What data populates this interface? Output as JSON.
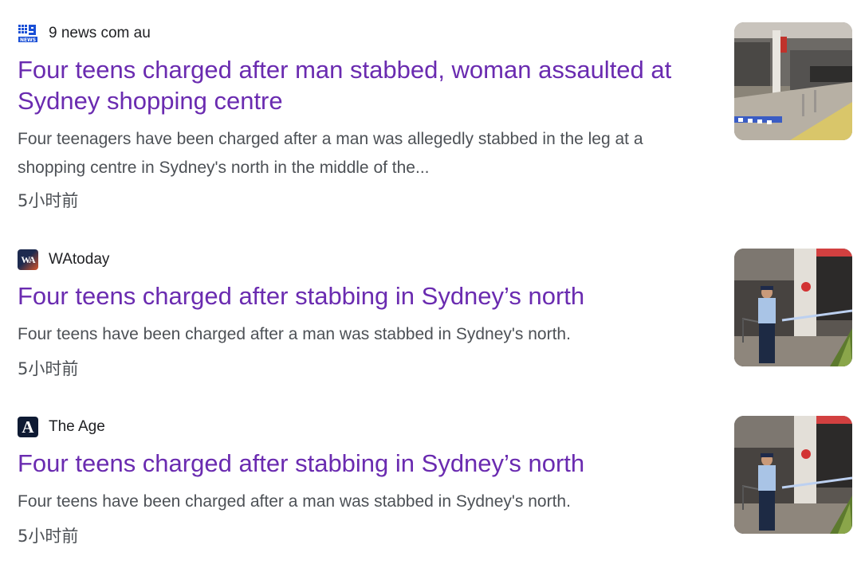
{
  "results": [
    {
      "source": "9 news com au",
      "favicon": "9news-logo-icon",
      "title": "Four teens charged after man stabbed, woman assaulted at Sydney shopping centre",
      "snippet": "Four teenagers have been charged after a man was allegedly stabbed in the leg at a shopping centre in Sydney's north in the middle of the...",
      "time": "5小时前",
      "thumbnail": "shopping-centre-cordon-photo"
    },
    {
      "source": "WAtoday",
      "favicon": "watoday-logo-icon",
      "favicon_text": "WA",
      "title": "Four teens charged after stabbing in Sydney’s north",
      "snippet": "Four teens have been charged after a man was stabbed in Sydney's north.",
      "time": "5小时前",
      "thumbnail": "police-officer-photo"
    },
    {
      "source": "The Age",
      "favicon": "the-age-logo-icon",
      "favicon_text": "A",
      "title": "Four teens charged after stabbing in Sydney’s north",
      "snippet": "Four teens have been charged after a man was stabbed in Sydney's north.",
      "time": "5小时前",
      "thumbnail": "police-officer-photo"
    }
  ],
  "colors": {
    "headline": "#6a2bb0",
    "source": "#202124",
    "snippet": "#4d5156",
    "nine_news_blue": "#1a4fd6"
  }
}
